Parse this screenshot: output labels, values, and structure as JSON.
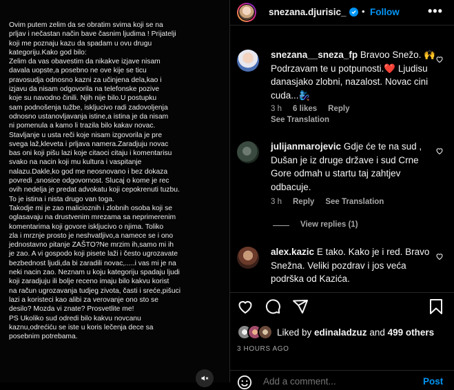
{
  "post": {
    "caption": "Ovim putem zelim da se obratim svima koji se na\nprljav i nečastan način bave časnim ljudima ! Prijatelji\nkoji me poznaju kazu da spadam u ovu drugu\nkategoriju.Kako god bilo:\nZelim da vas obavestim da nikakve izjave nisam\ndavala uopste,a posebno ne ove kije se ticu\npravosudja odnosno kazni za učinjena dela,kao i\nizjavu da  nisam odgovorila na telefonske pozive\nkoje su navodno činili. Njih nije bilo.U postupku\nsam podnošenja tužbe, iskljucivo radi zadovoljenja\nodnosno ustanovljavanja istine,a istina je da nisam\nni pomenula a kamo li trazila bilo kakav novac.\nStavljanje u usta reči koje nisam izgovorila je pre\nsvega laž,kleveta i prljava namera.Zaradjuju novac\nbas oni koji pišu lazi koje citaoci citaju i komentarisu\nsvako na nacin koji mu kultura i vaspitanje\nnalazu.Dakle,ko god me  neosnovano i bez dokaza\npovredi ,snosice odgovornost. Slucaj  o kome je rec\novih nedelja je predat advokatu koji cepokrenuti tuzbu.\nTo je istina i nista drugo van toga.\nTakodje mi je zao malicioznih i zlobnih osoba koji se\noglasavaju na drustvenim mrezama sa neprimerenim\nkomentarima koji govore iskljucivo o njima. Toliko\nzla i mrznje prosto je neshvatljivo,a namece se i ono\njednostavno pitanje ZAŠTO?Ne mrzim ih,samo mi ih\nje zao. A vi gospodo koji pisete laži i često ugrozavate\nbezbednost ljudi,da bi zaradili novac,.....i vas mi je na\nneki nacin zao.  Neznam u koju kategoriju spadaju ljudi\nkoji zaradjuju ili bolje receno imaju bilo kakvu korist\nna račun ugrozavanja tudjeg zivota, časti i sreće,pišuci\nlazi a koristeci kao alibi za verovanje ono sto se\ndesilo? Mozda vi znate? Prosvetlite me!\nPS Ukoliko sud odredi bilo kakvu novcanu\nkaznu,odrećiću se iste u koris lečenja dece sa\nposebnim potrebama."
  },
  "header": {
    "username": "snezana.djurisic_",
    "separator": "•",
    "follow_label": "Follow",
    "more_label": "•••"
  },
  "comments": [
    {
      "username": "snezana__sneza_fp",
      "text": "Bravoo Snežo. 🙌 Podrzavam te u potpunosti.❤️ Ljudisu danasjako zlobni, nazalost. Novac cini cuda...🧞‍♀️",
      "time": "3 h",
      "likes": "6 likes",
      "reply": "Reply",
      "see_translation": "See Translation"
    },
    {
      "username": "julijanmarojevic",
      "text": "Gdje će te na sud , Dušan je iz druge države i sud Crne Gore odmah u startu taj zahtjev odbacuje.",
      "time": "3 h",
      "reply": "Reply",
      "see_translation": "See Translation",
      "view_replies": "View replies (1)"
    },
    {
      "username": "alex.kazic",
      "text": "E tako. Kako je i red. Bravo Snežna. Veliki pozdrav i jos veća podrška od Kazića."
    }
  ],
  "actions": {
    "liked_by_prefix": "Liked by ",
    "liked_by_user": "edinaladzuz",
    "liked_by_and": " and ",
    "others": "499 others",
    "time_ago": "3 HOURS AGO",
    "add_comment_placeholder": "Add a comment...",
    "post_label": "Post"
  },
  "colors": {
    "accent": "#0095f6",
    "background": "#000000",
    "muted": "#a8a8a8"
  }
}
